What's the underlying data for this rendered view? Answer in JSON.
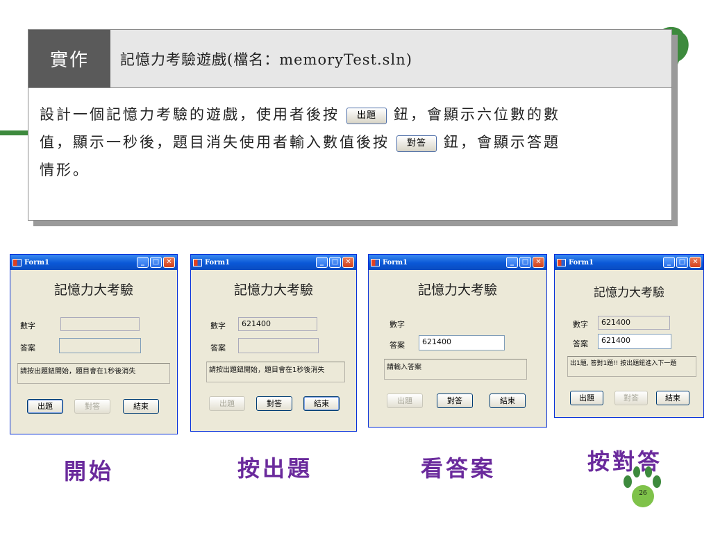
{
  "task": {
    "tag": "實作",
    "title": "記憶力考驗遊戲(檔名：memoryTest.sln)",
    "line1_a": "設計一個記憶力考驗的遊戲，使用者後按",
    "btn1": "出題",
    "line1_b": "鈕，會顯示六位數的數",
    "line2_a": "值，顯示一秒後，題目消失使用者輸入數值後按",
    "btn2": "對答",
    "line2_b": "鈕，會顯示答題",
    "line3": "情形。"
  },
  "windows": [
    {
      "title": "Form1",
      "heading": "記憶力大考驗",
      "number_label": "數字",
      "number_value": "",
      "answer_label": "答案",
      "answer_value": "",
      "message": "請按出題鈕開始，題目會在1秒後消失",
      "btn_question": "出題",
      "btn_answer": "對答",
      "btn_end": "結束",
      "caption": "開始"
    },
    {
      "title": "Form1",
      "heading": "記憶力大考驗",
      "number_label": "數字",
      "number_value": "621400",
      "answer_label": "答案",
      "answer_value": "",
      "message": "請按出題鈕開始，題目會在1秒後消失",
      "btn_question": "出題",
      "btn_answer": "對答",
      "btn_end": "結束",
      "caption": "按出題"
    },
    {
      "title": "Form1",
      "heading": "記憶力大考驗",
      "number_label": "數字",
      "number_value": "",
      "answer_label": "答案",
      "answer_value": "621400",
      "message": "請輸入答案",
      "btn_question": "出題",
      "btn_answer": "對答",
      "btn_end": "結束",
      "caption": "看答案"
    },
    {
      "title": "Form1",
      "heading": "記憶力大考驗",
      "number_label": "數字",
      "number_value": "621400",
      "answer_label": "答案",
      "answer_value": "621400",
      "message": "出1題, 答對1題!! 按出題鈕進入下一題",
      "btn_question": "出題",
      "btn_answer": "對答",
      "btn_end": "結束",
      "caption": "按對答"
    }
  ],
  "page_number": "26",
  "colors": {
    "caption": "#6a2a9c",
    "accent_green": "#3d8a3d",
    "titlebar": "#0a58d6"
  }
}
